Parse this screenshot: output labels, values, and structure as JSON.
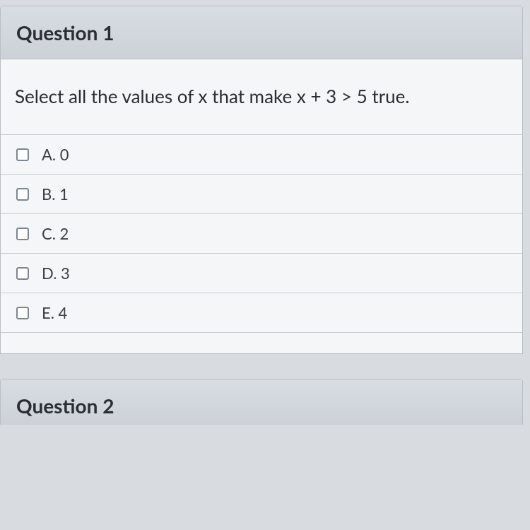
{
  "question1": {
    "title": "Question 1",
    "prompt": "Select all the values of x that make x + 3 > 5 true.",
    "options": [
      {
        "label": "A. 0"
      },
      {
        "label": "B. 1"
      },
      {
        "label": "C. 2"
      },
      {
        "label": "D. 3"
      },
      {
        "label": "E. 4"
      }
    ]
  },
  "question2": {
    "title": "Question 2"
  }
}
